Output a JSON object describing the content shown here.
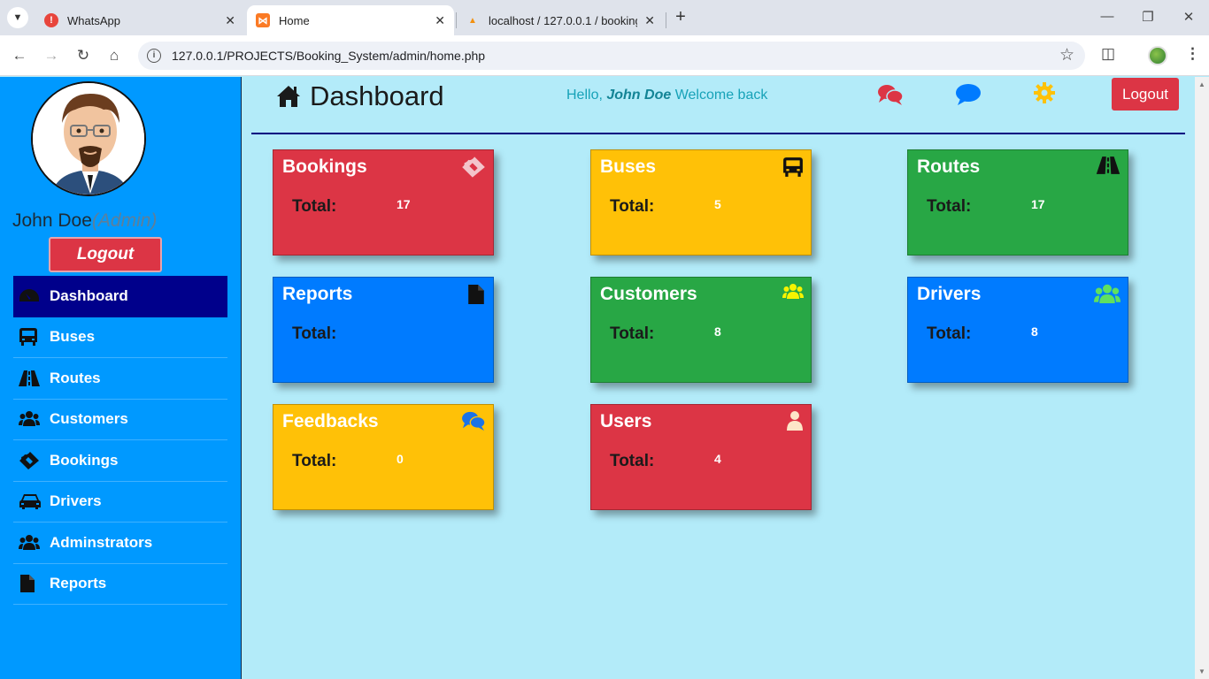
{
  "browser": {
    "tabs": [
      {
        "title": "WhatsApp",
        "favicon": "whatsapp-alert-icon"
      },
      {
        "title": "Home",
        "favicon": "xampp-icon",
        "active": true
      },
      {
        "title": "localhost / 127.0.0.1 / booking_",
        "favicon": "phpmyadmin-icon"
      }
    ],
    "url": "127.0.0.1/PROJECTS/Booking_System/admin/home.php"
  },
  "sidebar": {
    "user_name": "John Doe",
    "user_role": "(Admin)",
    "logout_label": "Logout",
    "items": [
      {
        "label": "Dashboard",
        "icon": "dashboard-icon",
        "active": true
      },
      {
        "label": "Buses",
        "icon": "bus-icon"
      },
      {
        "label": "Routes",
        "icon": "road-icon"
      },
      {
        "label": "Customers",
        "icon": "users-icon"
      },
      {
        "label": "Bookings",
        "icon": "ticket-icon"
      },
      {
        "label": "Drivers",
        "icon": "car-icon"
      },
      {
        "label": "Adminstrators",
        "icon": "users-icon"
      },
      {
        "label": "Reports",
        "icon": "file-icon"
      }
    ]
  },
  "header": {
    "title": "Dashboard",
    "greeting_prefix": "Hello,",
    "greeting_name": "John Doe",
    "greeting_suffix": "Welcome back",
    "logout_label": "Logout"
  },
  "cards": [
    {
      "title": "Bookings",
      "total_label": "Total:",
      "value": "17",
      "color": "#dc3545",
      "icon": "ticket-icon"
    },
    {
      "title": "Buses",
      "total_label": "Total:",
      "value": "5",
      "color": "#ffc107",
      "icon": "bus-icon"
    },
    {
      "title": "Routes",
      "total_label": "Total:",
      "value": "17",
      "color": "#28a745",
      "icon": "road-icon"
    },
    {
      "title": "Reports",
      "total_label": "Total:",
      "value": "",
      "color": "#007bff",
      "icon": "file-icon"
    },
    {
      "title": "Customers",
      "total_label": "Total:",
      "value": "8",
      "color": "#28a745",
      "icon": "users-icon"
    },
    {
      "title": "Drivers",
      "total_label": "Total:",
      "value": "8",
      "color": "#007bff",
      "icon": "users-icon"
    },
    {
      "title": "Feedbacks",
      "total_label": "Total:",
      "value": "0",
      "color": "#ffc107",
      "icon": "comments-icon"
    },
    {
      "title": "Users",
      "total_label": "Total:",
      "value": "4",
      "color": "#dc3545",
      "icon": "user-icon"
    }
  ]
}
